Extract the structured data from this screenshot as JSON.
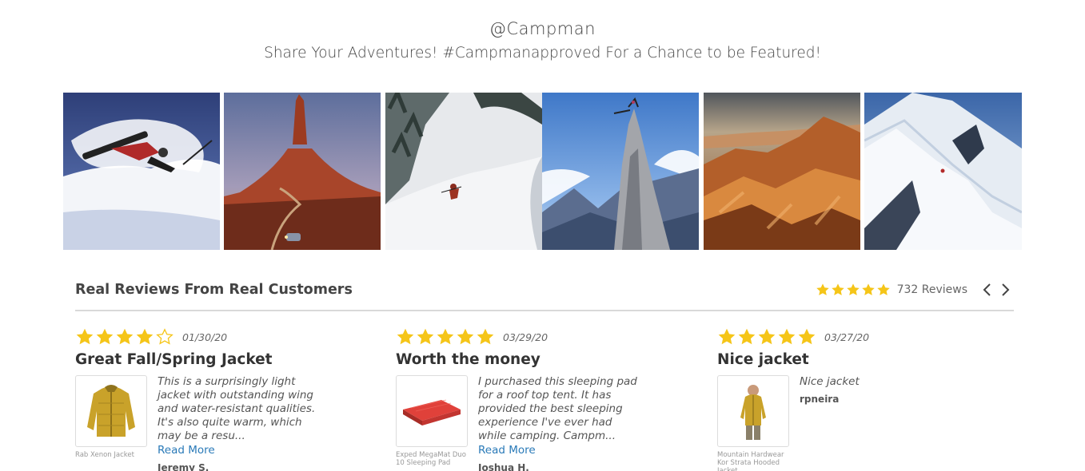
{
  "header": {
    "handle": "@Campman",
    "tagline": "Share Your Adventures! #Campmanapproved For a Chance to be Featured!"
  },
  "gallery": {
    "photos": [
      {
        "subject": "skier-jumping-snow"
      },
      {
        "subject": "red-rock-butte-road"
      },
      {
        "subject": "skier-powder-slope"
      },
      {
        "subject": "climber-rock-spire"
      },
      {
        "subject": "desert-canyon-sunset"
      },
      {
        "subject": "snowy-mountain-ridge"
      }
    ]
  },
  "reviews_section": {
    "title": "Real Reviews From Real Customers",
    "average_rating": 5,
    "count_label": "732 Reviews",
    "prev_icon": "chevron-left-icon",
    "next_icon": "chevron-right-icon"
  },
  "reviews": [
    {
      "rating": 4,
      "date": "01/30/20",
      "title": "Great Fall/Spring Jacket",
      "excerpt": "This is a surprisingly light jacket with outstanding wing and water-resistant qualities. It's also quite warm, which may be a resu...",
      "read_more": "Read More",
      "author": "Jeremy S.",
      "product_name": "Rab Xenon Jacket",
      "product_icon": "yellow-jacket-icon"
    },
    {
      "rating": 5,
      "date": "03/29/20",
      "title": "Worth the money",
      "excerpt": "I purchased this sleeping pad for a roof top tent. It has provided the best sleeping experience I've ever had while camping. Campm...",
      "read_more": "Read More",
      "author": "Joshua H.",
      "product_name": "Exped MegaMat Duo 10 Sleeping Pad",
      "product_icon": "sleeping-pad-icon"
    },
    {
      "rating": 5,
      "date": "03/27/20",
      "title": "Nice jacket",
      "excerpt": "Nice jacket",
      "read_more": "",
      "author": "rpneira",
      "product_name": "Mountain Hardwear Kor Strata Hooded Jacket",
      "product_icon": "hooded-jacket-icon"
    }
  ],
  "colors": {
    "star": "#f5c518",
    "star_empty_stroke": "#f5c518",
    "link": "#2a7ab8",
    "divider": "#d9d9d9"
  }
}
